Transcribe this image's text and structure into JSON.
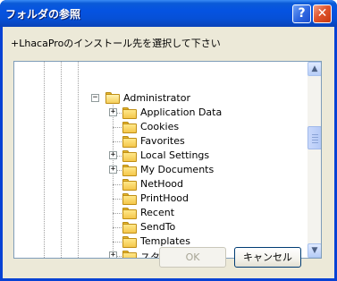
{
  "window": {
    "title": "フォルダの参照",
    "help_label": "?",
    "close_label": "✕"
  },
  "prompt": "+LhacaProのインストール先を選択して下さい",
  "tree": {
    "parent": {
      "label": "Administrator",
      "expanded": true
    },
    "items": [
      {
        "label": "Application Data",
        "expander": "+"
      },
      {
        "label": "Cookies",
        "expander": ""
      },
      {
        "label": "Favorites",
        "expander": ""
      },
      {
        "label": "Local Settings",
        "expander": "+"
      },
      {
        "label": "My Documents",
        "expander": "+"
      },
      {
        "label": "NetHood",
        "expander": ""
      },
      {
        "label": "PrintHood",
        "expander": ""
      },
      {
        "label": "Recent",
        "expander": ""
      },
      {
        "label": "SendTo",
        "expander": ""
      },
      {
        "label": "Templates",
        "expander": ""
      },
      {
        "label": "スタート メニュー",
        "expander": "+"
      }
    ],
    "parent_expander": "−"
  },
  "scrollbar": {
    "up": "▲",
    "down": "▼"
  },
  "buttons": {
    "ok": "OK",
    "cancel": "キャンセル"
  }
}
